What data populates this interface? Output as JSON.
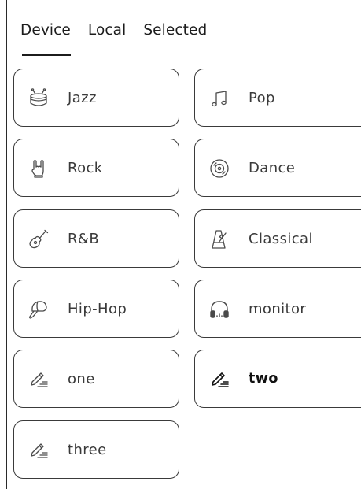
{
  "tabs": [
    {
      "label": "Device",
      "active": true
    },
    {
      "label": "Local",
      "active": false
    },
    {
      "label": "Selected",
      "active": false
    }
  ],
  "presets": [
    {
      "label": "Jazz",
      "icon": "drum-icon"
    },
    {
      "label": "Pop",
      "icon": "music-note-icon"
    },
    {
      "label": "Rock",
      "icon": "rock-hand-icon"
    },
    {
      "label": "Dance",
      "icon": "vinyl-disc-icon"
    },
    {
      "label": "R&B",
      "icon": "guitar-icon"
    },
    {
      "label": "Classical",
      "icon": "metronome-icon"
    },
    {
      "label": "Hip-Hop",
      "icon": "cap-icon"
    },
    {
      "label": "monitor",
      "icon": "headphones-icon"
    },
    {
      "label": "one",
      "icon": "pencil-edit-icon"
    },
    {
      "label": "two",
      "icon": "pencil-edit-icon",
      "selected": true
    },
    {
      "label": "three",
      "icon": "pencil-edit-icon"
    }
  ],
  "colors": {
    "text": "#3a3a3a",
    "border": "#3a3a3a",
    "active": "#1c1c1c"
  }
}
